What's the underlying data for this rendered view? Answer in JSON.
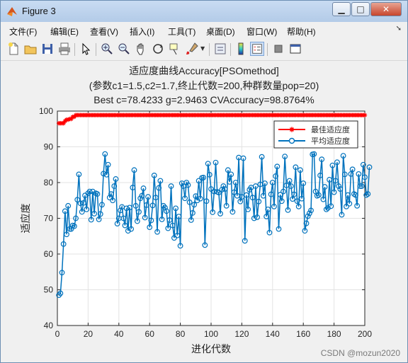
{
  "window": {
    "title": "Figure 3"
  },
  "menu": [
    {
      "label": "文件(F)"
    },
    {
      "label": "编辑(E)"
    },
    {
      "label": "查看(V)"
    },
    {
      "label": "插入(I)"
    },
    {
      "label": "工具(T)"
    },
    {
      "label": "桌面(D)"
    },
    {
      "label": "窗口(W)"
    },
    {
      "label": "帮助(H)"
    }
  ],
  "toolbar_icons": [
    "new-figure-icon",
    "open-file-icon",
    "save-icon",
    "print-icon",
    "arrow-select-icon",
    "zoom-in-icon",
    "zoom-out-icon",
    "pan-hand-icon",
    "rotate-3d-icon",
    "data-cursor-icon",
    "brush-icon",
    "link-plot-icon",
    "colorbar-icon",
    "legend-icon",
    "hide-plot-tools-icon",
    "show-plot-tools-icon"
  ],
  "plot": {
    "title_line1": "适应度曲线Accuracy[PSOmethod]",
    "title_line2": "(参数c1=1.5,c2=1.7,终止代数=200,种群数量pop=20)",
    "title_line3": "Best c=78.4233 g=2.9463 CVAccuracy=98.8764%",
    "xlabel": "进化代数",
    "ylabel": "适应度"
  },
  "watermark": "CSDN @mozun2020",
  "chart_data": {
    "type": "line",
    "xlim": [
      0,
      200
    ],
    "ylim": [
      40,
      100
    ],
    "xticks": [
      0,
      20,
      40,
      60,
      80,
      100,
      120,
      140,
      160,
      180,
      200
    ],
    "yticks": [
      40,
      50,
      60,
      70,
      80,
      90,
      100
    ],
    "grid": true,
    "legend_position": "top-right",
    "series": [
      {
        "name": "最佳适应度",
        "color": "#ff0000",
        "marker": "asterisk",
        "x": [
          1,
          3,
          5,
          6,
          8,
          10,
          12,
          200
        ],
        "y": [
          96.6,
          96.6,
          97.2,
          97.6,
          97.8,
          98.4,
          98.88,
          98.88
        ]
      },
      {
        "name": "平均适应度",
        "color": "#0072bd",
        "marker": "circle",
        "values": [
          48.5,
          49,
          54.8,
          62.8,
          72,
          65.5,
          73.5,
          67,
          67,
          68,
          67.8,
          70,
          75.2,
          82.3,
          74.2,
          71.8,
          74.3,
          76.4,
          72.5,
          77,
          77.5,
          69.6,
          77.5,
          71.3,
          77,
          76.8,
          69.7,
          71.2,
          73.8,
          82.5,
          88,
          82.2,
          85,
          75.8,
          76.8,
          75,
          79,
          81,
          68.5,
          70,
          72.2,
          73.2,
          70,
          68,
          72.8,
          66.5,
          73,
          67,
          78.6,
          83.5,
          73.5,
          69.2,
          71.8,
          75.6,
          76.3,
          78.4,
          70.2,
          73.7,
          76,
          67.5,
          69.4,
          73.6,
          82,
          75.8,
          66.2,
          78.5,
          80.5,
          69.7,
          73.5,
          73,
          72,
          67.2,
          69.5,
          79,
          68,
          64.5,
          72.8,
          65.2,
          70.5,
          62.3,
          79.8,
          79,
          75.6,
          80,
          79.3,
          74.5,
          69.5,
          71.5,
          73.8,
          76.2,
          75,
          80.5,
          75.5,
          81.3,
          81.4,
          62.5,
          74.8,
          85.3,
          82.2,
          78.2,
          71.7,
          77.5,
          85.6,
          77.4,
          77.2,
          71.3,
          78,
          79,
          78.2,
          73.5,
          83.5,
          80.2,
          82.3,
          71.8,
          77.3,
          80,
          76.3,
          87,
          74.7,
          76,
          86.8,
          63.7,
          76.5,
          72.5,
          78,
          78.6,
          75.8,
          70,
          79,
          70.3,
          74.7,
          79.5,
          87.2,
          76.3,
          79.8,
          70.5,
          72.5,
          66,
          76.7,
          80,
          73.3,
          81.8,
          84.5,
          67,
          76.6,
          74.8,
          77.5,
          87.3,
          79.2,
          72.3,
          80.5,
          79,
          75.4,
          76.7,
          84.3,
          74.8,
          73.3,
          83.5,
          75.5,
          79.8,
          66.5,
          68.6,
          70.6,
          71.4,
          72.2,
          87.9,
          88,
          77.5,
          76.3,
          76.5,
          82,
          86.5,
          75.3,
          78.8,
          72.5,
          72.9,
          80.8,
          73.4,
          84.8,
          77.3,
          80.5,
          85.7,
          79,
          78.2,
          71,
          87.5,
          82.3,
          73.3,
          76.5,
          74.1,
          82.4,
          83.7,
          76.8,
          76.5,
          73.5,
          82.4,
          79,
          79,
          85,
          81.5,
          76.5,
          76.8,
          84.3
        ]
      }
    ]
  }
}
